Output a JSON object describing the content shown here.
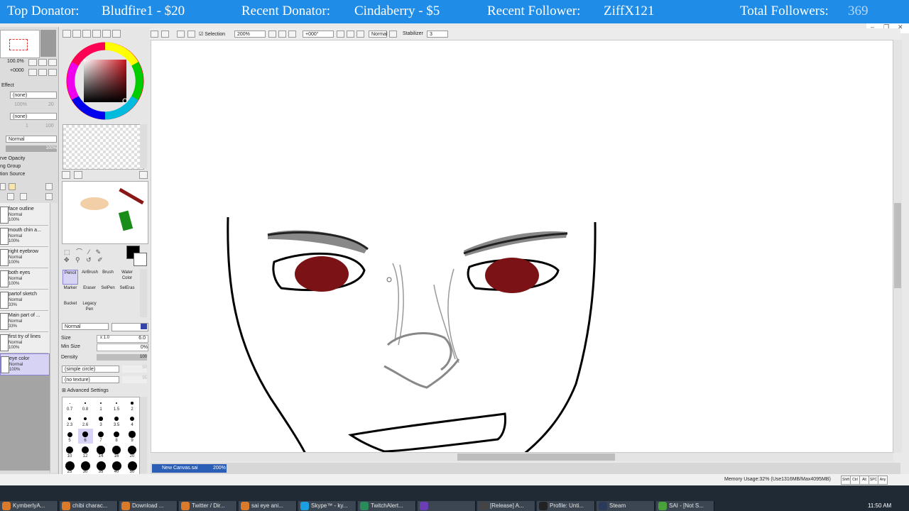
{
  "banner": {
    "top_donator_label": "Top Donator:",
    "top_donator_value": "Bludfire1 - $20",
    "recent_donator_label": "Recent Donator:",
    "recent_donator_value": "Cindaberry - $5",
    "recent_follower_label": "Recent Follower:",
    "recent_follower_value": "ZiffX121",
    "total_followers_label": "Total Followers:",
    "total_followers_value": "369"
  },
  "layer_panel": {
    "opacity_value": "100.0%",
    "offset_value": "+0000",
    "effect_label": "Effect",
    "texture_select": "(none)",
    "effect_select": "(none)",
    "texture_scale": "100%",
    "texture_strength": "20",
    "effect_width": "1",
    "effect_strength": "100",
    "blend_mode": "Normal",
    "opacity_bar": "100%",
    "checks": [
      "rve Opacity",
      "ng Group",
      "tion Source"
    ],
    "layers": [
      {
        "name": "face outline",
        "mode": "Normal",
        "opacity": "100%"
      },
      {
        "name": "mouth chin a...",
        "mode": "Normal",
        "opacity": "100%"
      },
      {
        "name": "right eyebrow",
        "mode": "Normal",
        "opacity": "100%"
      },
      {
        "name": "both eyes",
        "mode": "Normal",
        "opacity": "100%"
      },
      {
        "name": "partof sketch",
        "mode": "Normal",
        "opacity": "33%"
      },
      {
        "name": "Main part of ...",
        "mode": "Normal",
        "opacity": "33%"
      },
      {
        "name": "first try of lines",
        "mode": "Normal",
        "opacity": "100%"
      },
      {
        "name": "eye color",
        "mode": "Normal",
        "opacity": "100%"
      }
    ]
  },
  "tools": {
    "items": [
      "Pencil",
      "AirBrush",
      "Brush",
      "Water Color",
      "Marker",
      "Eraser",
      "SelPen",
      "SelEras",
      "Bucket",
      "Legacy Pen"
    ],
    "blend_mode": "Normal",
    "size_label": "Size",
    "size_mult": "x 1.0",
    "size_value": "6.0",
    "min_size_label": "Min Size",
    "min_size_value": "0%",
    "density_label": "Density",
    "density_value": "100",
    "shape_select": "(simple circle)",
    "shape_value": "50",
    "texture_select": "(no texture)",
    "texture_value": "95",
    "advanced": "Advanced Settings",
    "brush_sizes": [
      "0.7",
      "0.8",
      "1",
      "1.5",
      "2",
      "2.3",
      "2.6",
      "3",
      "3.5",
      "4",
      "5",
      "6",
      "7",
      "8",
      "9",
      "10",
      "12",
      "14",
      "16",
      "20",
      "25",
      "30",
      "35",
      "40",
      "50"
    ],
    "selected_size": "6"
  },
  "toolbar": {
    "selection_label": "Selection",
    "zoom": "200%",
    "rotation": "+000°",
    "mode": "Normal",
    "stabilizer_label": "Stabilizer",
    "stabilizer_value": "3"
  },
  "tab": {
    "name": "New Canvas.sai",
    "zoom": "200%"
  },
  "status": {
    "memory": "Memory Usage:32% (Use1316MB/Max4095MB)",
    "keys": [
      "Shift",
      "Ctrl",
      "Alt",
      "SPC",
      "Any"
    ]
  },
  "taskbar": {
    "items": [
      "KymberlyA...",
      "chibi charac...",
      "Download ...",
      "Twitter / Dir...",
      "sai eye ani...",
      "Skype™ - ky...",
      "TwitchAlert...",
      "",
      "[Release] A...",
      "Profile: Unti...",
      "Steam",
      "SAI - [Not S..."
    ],
    "clock": "11:50 AM"
  },
  "colors": {
    "banner": "#1f8de8",
    "eye_red": "#7a1216",
    "layer_active": "#d6d3f5"
  }
}
